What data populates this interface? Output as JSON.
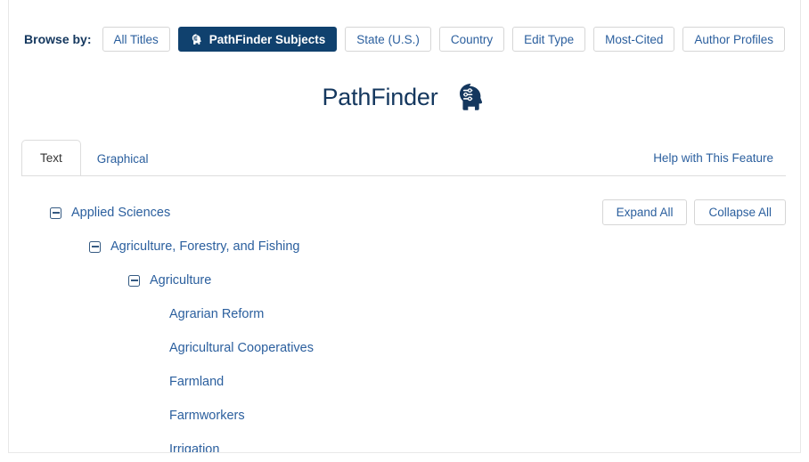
{
  "browse": {
    "label": "Browse by:",
    "buttons": [
      {
        "label": "All Titles",
        "active": false,
        "icon": null
      },
      {
        "label": "PathFinder Subjects",
        "active": true,
        "icon": "head-network-icon"
      },
      {
        "label": "State (U.S.)",
        "active": false,
        "icon": null
      },
      {
        "label": "Country",
        "active": false,
        "icon": null
      },
      {
        "label": "Edit Type",
        "active": false,
        "icon": null
      },
      {
        "label": "Most-Cited",
        "active": false,
        "icon": null
      },
      {
        "label": "Author Profiles",
        "active": false,
        "icon": null
      }
    ]
  },
  "header": {
    "title": "PathFinder",
    "icon": "head-network-icon"
  },
  "tabs": [
    {
      "label": "Text",
      "active": true
    },
    {
      "label": "Graphical",
      "active": false
    }
  ],
  "help_link": "Help with This Feature",
  "controls": {
    "expand_all": "Expand All",
    "collapse_all": "Collapse All"
  },
  "tree": [
    {
      "label": "Applied Sciences",
      "depth": 0,
      "expandable": true,
      "state": "expanded",
      "icon": "minus-box-icon"
    },
    {
      "label": "Agriculture, Forestry, and Fishing",
      "depth": 1,
      "expandable": true,
      "state": "expanded",
      "icon": "minus-box-icon"
    },
    {
      "label": "Agriculture",
      "depth": 2,
      "expandable": true,
      "state": "expanded",
      "icon": "minus-box-icon"
    },
    {
      "label": "Agrarian Reform",
      "depth": 3,
      "expandable": false,
      "state": "leaf",
      "icon": null
    },
    {
      "label": "Agricultural Cooperatives",
      "depth": 3,
      "expandable": false,
      "state": "leaf",
      "icon": null
    },
    {
      "label": "Farmland",
      "depth": 3,
      "expandable": false,
      "state": "leaf",
      "icon": null
    },
    {
      "label": "Farmworkers",
      "depth": 3,
      "expandable": false,
      "state": "leaf",
      "icon": null
    },
    {
      "label": "Irrigation",
      "depth": 3,
      "expandable": false,
      "state": "leaf",
      "icon": null
    }
  ],
  "colors": {
    "brand_navy": "#10416e",
    "link_blue": "#2b5f9e",
    "title_navy": "#14375e",
    "border_gray": "#d6d6d6",
    "rule_gray": "#dddddd"
  }
}
